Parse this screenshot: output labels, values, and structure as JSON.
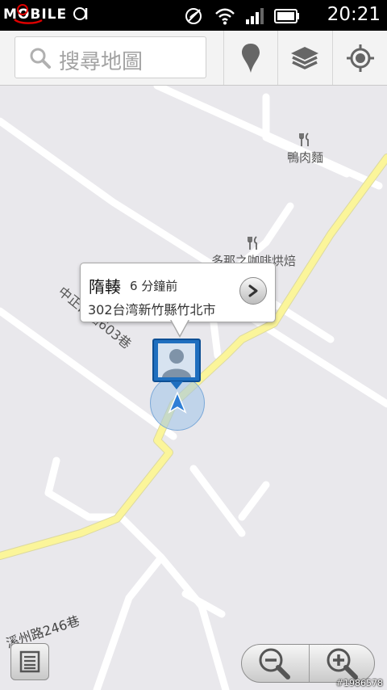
{
  "status_bar": {
    "logo_text": "MOBILE01",
    "time": "20:21"
  },
  "toolbar": {
    "search_placeholder": "搜尋地圖",
    "icons": [
      "places-pin-icon",
      "layers-icon",
      "my-location-icon"
    ]
  },
  "map": {
    "labels": {
      "road_zhongzheng": "中正西路603巷",
      "road_xizhou": "溪州路246巷",
      "poi_duck": "鴨肉麵",
      "poi_cafe": "多那之咖啡烘焙"
    }
  },
  "popup": {
    "name": "隋輳",
    "time_ago": "6 分鐘前",
    "address": "302台湾新竹縣竹北市"
  },
  "controls": {
    "menu_icon": "list-icon",
    "zoom_out_icon": "zoom-out-icon",
    "zoom_in_icon": "zoom-in-icon"
  },
  "watermark": "#1986578",
  "colors": {
    "map_background": "#e9e8ec",
    "main_road": "#fbf59a",
    "minor_road": "#ffffff",
    "accuracy_circle": "#9ec3ea",
    "marker_blue": "#1f6fbf"
  }
}
